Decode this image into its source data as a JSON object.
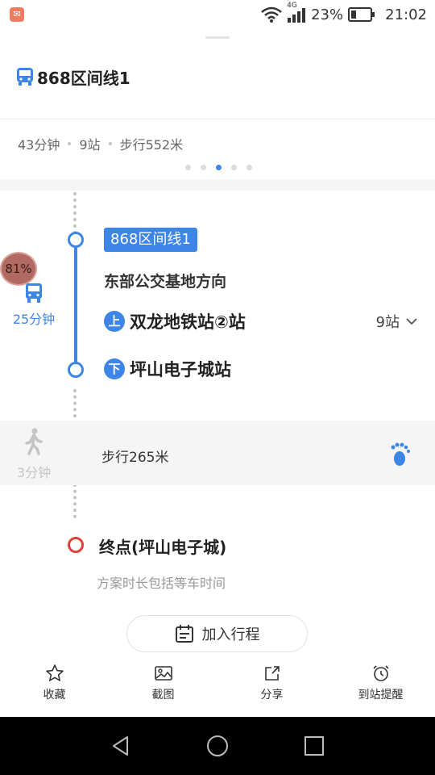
{
  "status_bar": {
    "network": "4G",
    "battery": "23%",
    "time": "21:02",
    "app_icon": "notification-icon"
  },
  "route": {
    "title": "868区间线1",
    "summary": {
      "duration": "43分钟",
      "stops": "9站",
      "walk": "步行552米"
    },
    "pager": {
      "total": 5,
      "active_index": 2
    }
  },
  "segments": {
    "bus": {
      "badge": "81%",
      "duration": "25分钟",
      "line": "868区间线1",
      "direction": "东部公交基地方向",
      "board_marker": "上",
      "board_stop": "双龙地铁站②站",
      "stops_count": "9站",
      "alight_marker": "下",
      "alight_stop": "坪山电子城站"
    },
    "walk": {
      "duration": "3分钟",
      "text": "步行265米"
    },
    "end": {
      "title": "终点(坪山电子城)",
      "note": "方案时长包括等车时间"
    }
  },
  "add_button": {
    "label": "加入行程"
  },
  "bottom_bar": {
    "items": [
      {
        "label": "收藏",
        "icon": "star-icon"
      },
      {
        "label": "截图",
        "icon": "image-icon"
      },
      {
        "label": "分享",
        "icon": "share-icon"
      },
      {
        "label": "到站提醒",
        "icon": "alarm-icon"
      }
    ]
  },
  "colors": {
    "accent": "#3d86e8",
    "end": "#e0413b",
    "muted": "#c4c4c4"
  }
}
